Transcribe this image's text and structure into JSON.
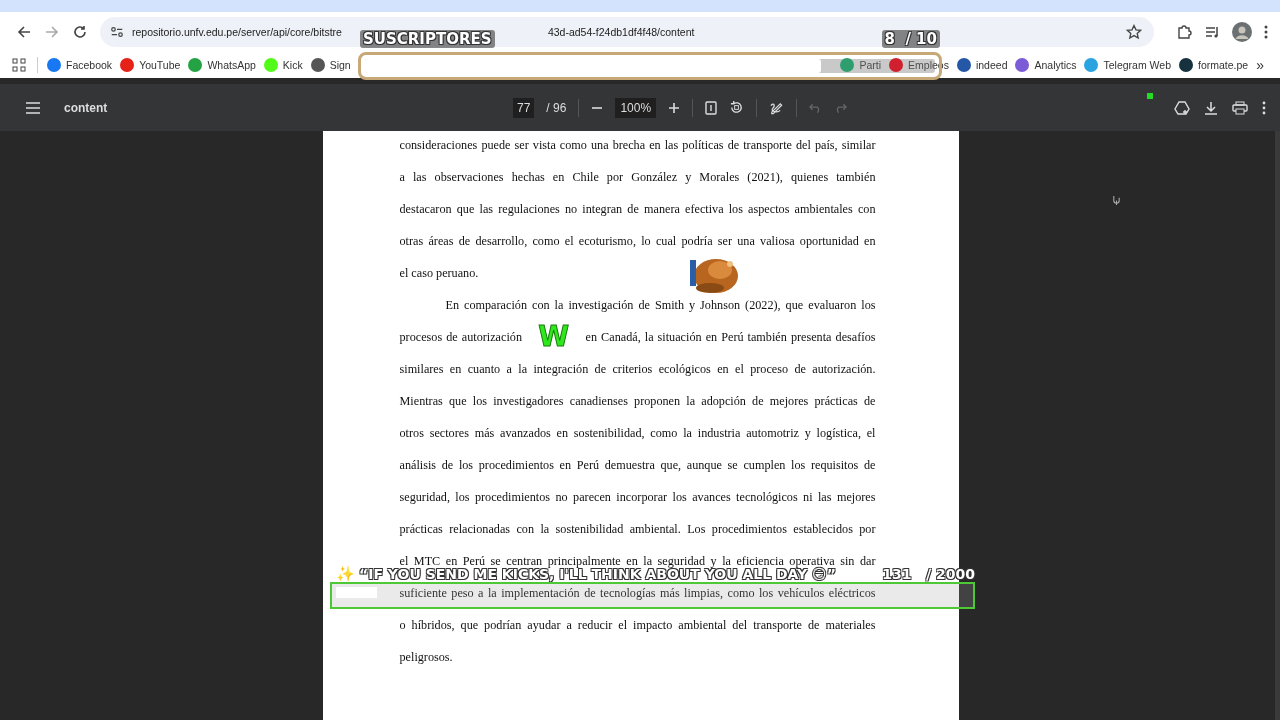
{
  "browser": {
    "url_start": "repositorio.unfv.edu.pe/server/api/core/bitstre",
    "url_end": "43d-ad54-f24db1df4f48/content",
    "bookmarks_left": [
      {
        "label": "Facebook",
        "color": "#1877f2"
      },
      {
        "label": "YouTube",
        "color": "#e62117"
      },
      {
        "label": "WhatsApp",
        "color": "#25a244"
      },
      {
        "label": "Kick",
        "color": "#53fc18"
      },
      {
        "label": "Sign",
        "color": "#555555"
      }
    ],
    "bookmarks_right": [
      {
        "label": "Parti",
        "color": "#2f9e6e"
      },
      {
        "label": "Empleos",
        "color": "#d02030"
      },
      {
        "label": "indeed",
        "color": "#2557a7"
      },
      {
        "label": "Analytics",
        "color": "#7b5cd6"
      },
      {
        "label": "Telegram Web",
        "color": "#2aa3e0"
      },
      {
        "label": "formate.pe",
        "color": "#16323f"
      }
    ],
    "more_bookmarks": "»"
  },
  "pdf_toolbar": {
    "title": "content",
    "page": "77",
    "page_total": "/ 96",
    "zoom": "100%",
    "undo_disabled": true,
    "redo_disabled": true
  },
  "document": {
    "paragraphs": [
      {
        "indent": false,
        "lines": [
          {
            "text": "consideraciones puede ser vista como una brecha en las políticas de transporte del país, similar"
          },
          {
            "text": "a las observaciones hechas en Chile por González y Morales (2021), quienes también"
          },
          {
            "text": "destacaron que las regulaciones no integran de manera efectiva los aspectos ambientales con"
          },
          {
            "text": "otras áreas de desarrollo, como el ecoturismo, lo cual podría ser una valiosa oportunidad en"
          },
          {
            "text": "el caso peruano."
          }
        ]
      },
      {
        "indent": true,
        "lines": [
          {
            "text": "En comparación con la investigación de Smith y Johnson (2022), que evaluaron los"
          },
          {
            "before": "procesos de autorización",
            "sticker": "W",
            "after": "en Canadá, la situación en Perú también presenta desafíos"
          },
          {
            "text": "similares en cuanto a la integración de criterios ecológicos en el proceso de autorización."
          },
          {
            "text": "Mientras que los investigadores canadienses proponen la adopción de mejores prácticas de"
          },
          {
            "text": "otros sectores más avanzados en sostenibilidad, como la industria automotriz y logística, el"
          },
          {
            "text": "análisis de los procedimientos en Perú demuestra que, aunque se cumplen los requisitos de"
          },
          {
            "text": "seguridad, los procedimientos no parecen incorporar los avances tecnológicos ni las mejores"
          },
          {
            "text": "prácticas relacionadas con la sostenibilidad ambiental. Los procedimientos establecidos por"
          },
          {
            "text": "el MTC en Perú se centran principalmente en la seguridad y la eficiencia operativa sin dar"
          },
          {
            "text": "suficiente peso a la implementación de tecnologías más limpias, como los vehículos eléctricos"
          },
          {
            "text": "o híbridos, que podrían ayudar a reducir el impacto ambiental del transporte de materiales"
          },
          {
            "text": "peligrosos."
          }
        ]
      }
    ]
  },
  "overlays": {
    "subscriber_goal": {
      "label": "SUSCRIPTORES",
      "count": "8",
      "total": "/ 10",
      "level": 0.8
    },
    "kicks_goal": {
      "icon": "✨",
      "message": "“IF YOU SEND ME KICKS, I'LL THINK ABOUT YOU ALL DAY 😏”",
      "count": "131",
      "total": "/ 2000",
      "level": 0.065
    }
  }
}
